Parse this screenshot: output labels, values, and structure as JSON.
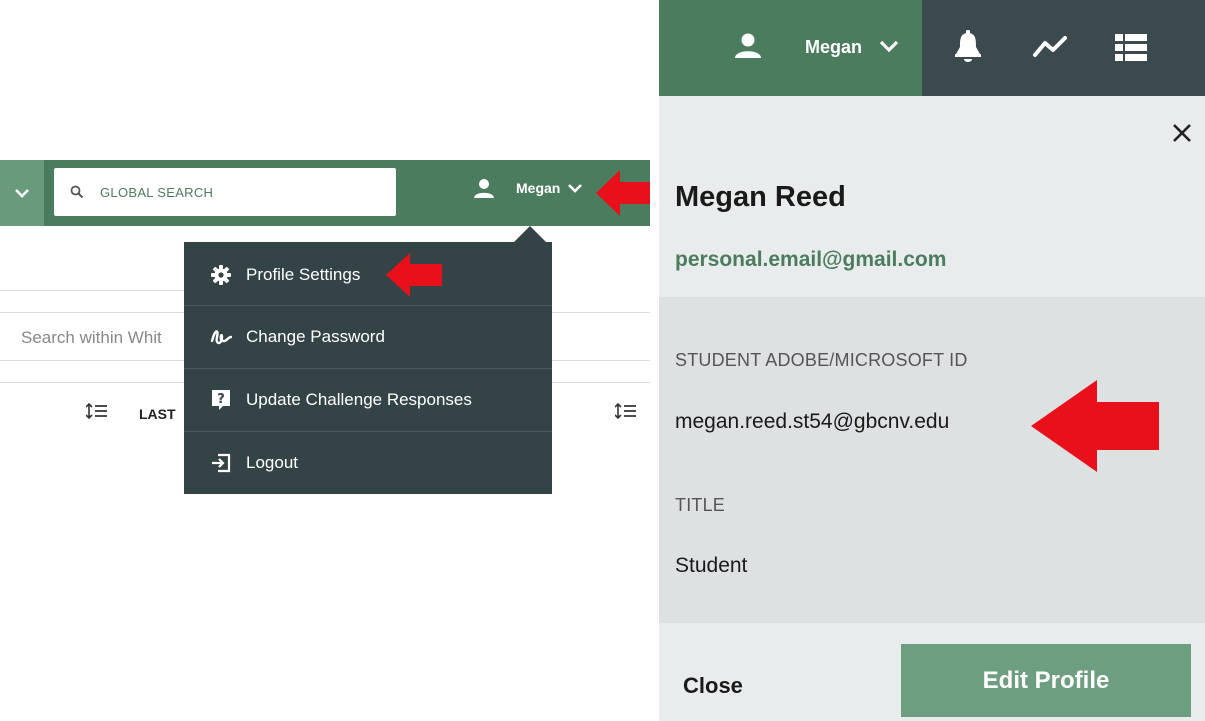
{
  "left": {
    "search": {
      "placeholder": "GLOBAL SEARCH"
    },
    "user": {
      "name": "Megan"
    },
    "search_within": "Search within Whit",
    "column_last": "LAST",
    "menu": {
      "items": [
        {
          "label": "Profile Settings",
          "icon": "gear-icon"
        },
        {
          "label": "Change Password",
          "icon": "signature-icon"
        },
        {
          "label": "Update Challenge Responses",
          "icon": "question-icon"
        },
        {
          "label": "Logout",
          "icon": "logout-icon"
        }
      ]
    }
  },
  "right": {
    "header": {
      "user_name": "Megan"
    },
    "profile": {
      "full_name": "Megan Reed",
      "email": "personal.email@gmail.com",
      "fields": [
        {
          "label": "STUDENT ADOBE/MICROSOFT ID",
          "value": "megan.reed.st54@gbcnv.edu"
        },
        {
          "label": "TITLE",
          "value": "Student"
        }
      ]
    },
    "footer": {
      "close_label": "Close",
      "edit_label": "Edit Profile"
    }
  },
  "colors": {
    "header_green": "#4c7c5e",
    "dark_slate": "#344346",
    "button_green": "#6e9e80",
    "annotation_red": "#e8101a"
  }
}
